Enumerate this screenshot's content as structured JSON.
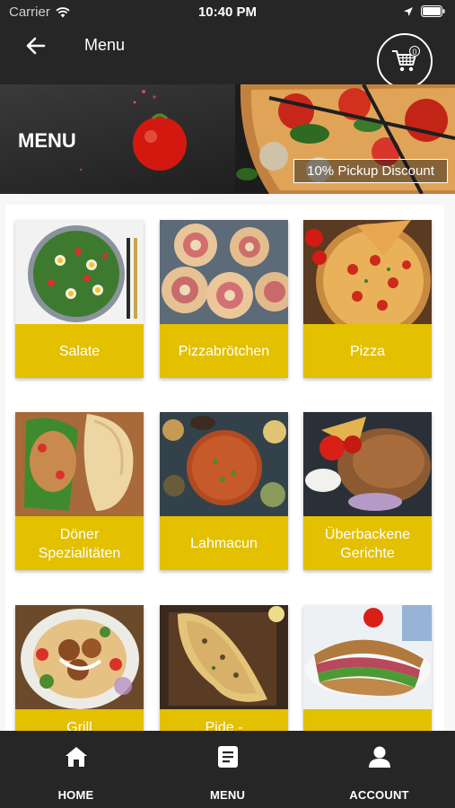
{
  "status_bar": {
    "carrier": "Carrier",
    "time": "10:40 PM"
  },
  "header": {
    "title": "Menu",
    "cart_count": "0"
  },
  "banner": {
    "title": "MENU",
    "discount": "10% Pickup Discount"
  },
  "categories": [
    {
      "label": "Salate"
    },
    {
      "label": "Pizzabrötchen"
    },
    {
      "label": "Pizza"
    },
    {
      "label": "Döner Spezialitäten"
    },
    {
      "label": "Lahmacun"
    },
    {
      "label": "Überbackene Gerichte"
    },
    {
      "label": "Grill"
    },
    {
      "label": "Pide -"
    },
    {
      "label": ""
    }
  ],
  "bottom_nav": [
    {
      "label": "HOME",
      "icon": "home-icon"
    },
    {
      "label": "MENU",
      "icon": "menu-list-icon"
    },
    {
      "label": "ACCOUNT",
      "icon": "account-icon"
    }
  ],
  "colors": {
    "bar": "#262626",
    "accent": "#e3c000",
    "background": "#f7f7f7"
  }
}
